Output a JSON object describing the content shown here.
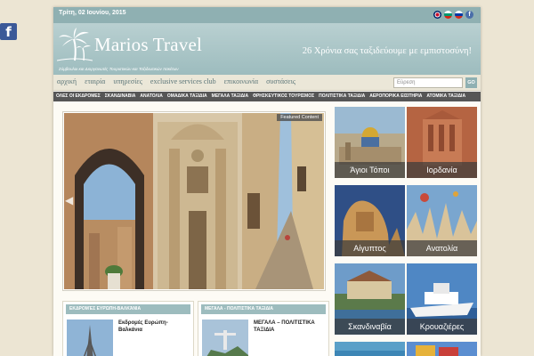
{
  "topbar": {
    "date": "Τρίτη, 02 Ιουνίου, 2015"
  },
  "header": {
    "logo_title": "Marios Travel",
    "logo_subtitle": "Σύμβουλοι και Διοργανωτές Τουριστικών και Ταξιδιωτικών πακέτων",
    "slogan": "26 Χρόνια σας ταξιδεύουμε με εμπιστοσύνη!"
  },
  "mainnav": {
    "items": [
      "αρχική",
      "εταιρία",
      "υπηρεσίες",
      "exclusive services club",
      "επικοινωνία",
      "συστάσεις"
    ],
    "search_placeholder": "Εύρεση",
    "go_label": "GO"
  },
  "catnav": {
    "items": [
      "ΟΛΕΣ ΟΙ ΕΚΔΡΟΜΕΣ",
      "ΣΚΑΝΔΙΝΑΒΙΑ",
      "ΑΝΑΤΟΛΙΑ",
      "ΟΜΑΔΙΚΑ ΤΑΞΙΔΙΑ",
      "ΜΕΓΑΛΑ ΤΑΞΙΔΙΑ",
      "ΘΡΗΣΚΕΥΤΙΚΟΣ ΤΟΥΡΙΣΜΟΣ",
      "ΠΟΛΙΤΙΣΤΙΚΑ ΤΑΞΙΔΙΑ",
      "ΑΕΡΟΠΟΡΙΚΑ ΕΙΣΙΤΗΡΙΑ",
      "ΑΤΟΜΙΚΑ ΤΑΞΙΔΙΑ"
    ]
  },
  "slider": {
    "badge": "Featured Content"
  },
  "tiles": [
    "Άγιοι Τόποι",
    "Ιορδανία",
    "Αίγυπτος",
    "Ανατολία",
    "Σκανδιναβία",
    "Κρουαζιέρες"
  ],
  "boxes": [
    {
      "header": "ΕΚΔΡΟΜΈΣ ΕΥΡΏΠΗ-ΒΑΛΚΆΝΙΑ",
      "title": "Εκδρομές Ευρώπη-Βαλκάνια"
    },
    {
      "header": "ΜΕΓΑΛΑ - ΠΟΛΙΤΙΣΤΙΚΑ ΤΑΞΙΔΙΑ",
      "title": "ΜΕΓΑΛΑ – ΠΟΛΙΤΙΣΤΙΚΑ ΤΑΞΙΔΙΑ"
    }
  ],
  "icons": {
    "side_facebook": "facebook-icon",
    "logo": "palm-tree-icon"
  }
}
